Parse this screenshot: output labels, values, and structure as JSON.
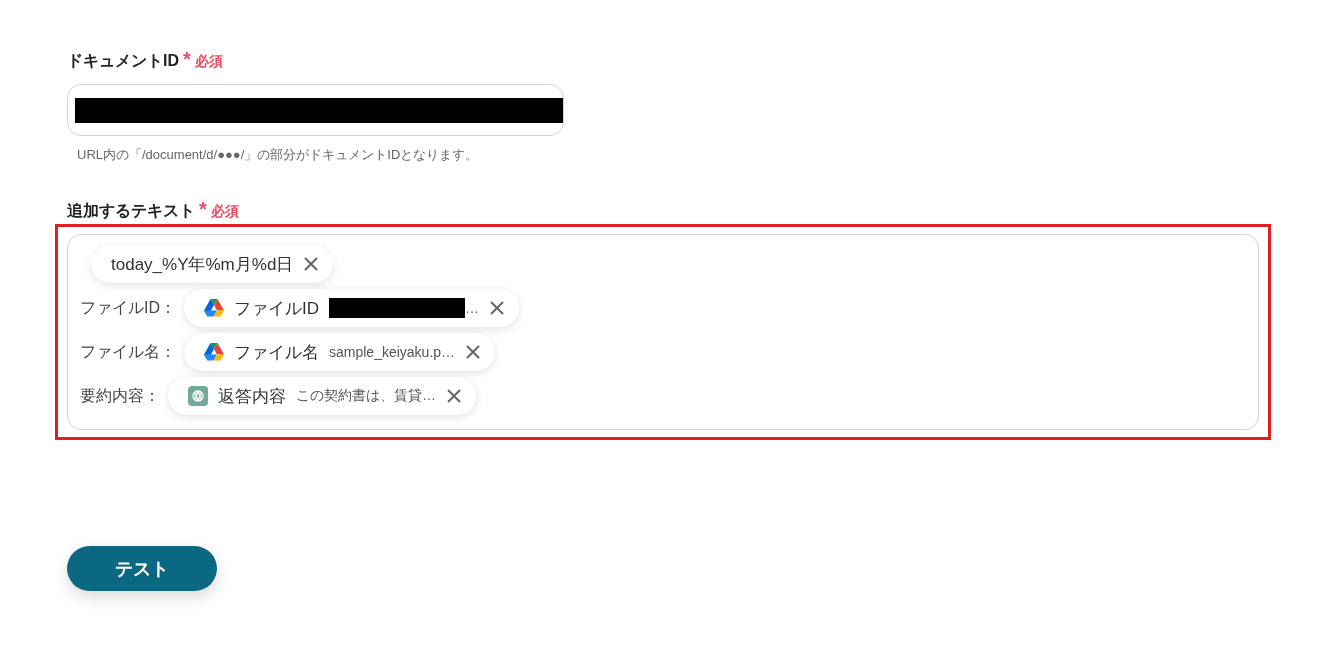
{
  "fields": [
    {
      "kind": "text",
      "label": "ドキュメントID",
      "required_mark": "*",
      "required_text": "必須",
      "value_redacted": true,
      "hint": "URL内の「/document/d/●●●/」の部分がドキュメントIDとなります。"
    },
    {
      "kind": "tokens",
      "label": "追加するテキスト",
      "required_mark": "*",
      "required_text": "必須",
      "highlighted": true,
      "lines": [
        {
          "chip": {
            "kind": "plain",
            "label": "today_%Y年%m月%d日"
          }
        },
        {
          "prefix": "ファイルID：",
          "chip": {
            "kind": "drive",
            "label": "ファイルID",
            "value_redacted": true,
            "value": "…"
          }
        },
        {
          "prefix": "ファイル名：",
          "chip": {
            "kind": "drive",
            "label": "ファイル名",
            "value": "sample_keiyaku.p…"
          }
        },
        {
          "prefix": "要約内容：",
          "chip": {
            "kind": "chat",
            "label": "返答内容",
            "value": "この契約書は、賃貸…"
          }
        }
      ]
    }
  ],
  "button": {
    "label": "テスト"
  }
}
